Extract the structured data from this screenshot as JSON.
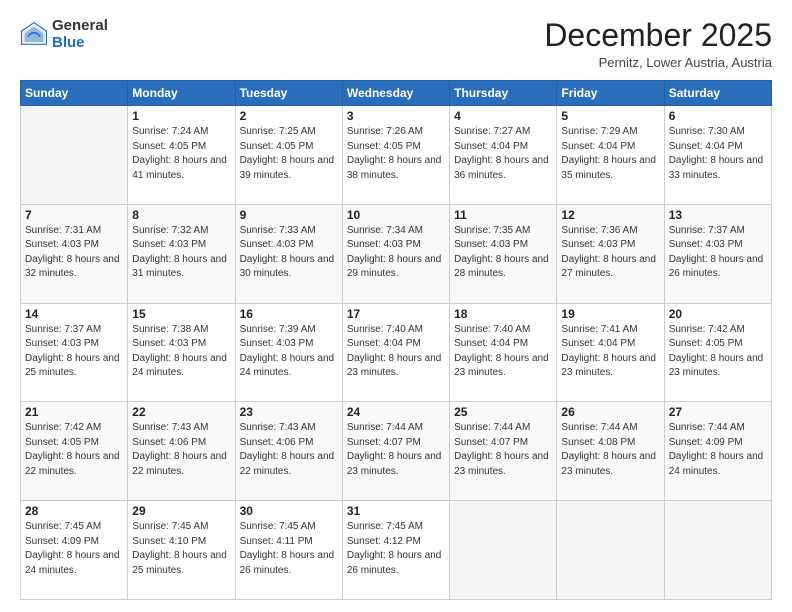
{
  "logo": {
    "general": "General",
    "blue": "Blue"
  },
  "header": {
    "month": "December 2025",
    "location": "Pernitz, Lower Austria, Austria"
  },
  "days": [
    "Sunday",
    "Monday",
    "Tuesday",
    "Wednesday",
    "Thursday",
    "Friday",
    "Saturday"
  ],
  "weeks": [
    [
      {
        "num": "",
        "sunrise": "",
        "sunset": "",
        "daylight": ""
      },
      {
        "num": "1",
        "sunrise": "Sunrise: 7:24 AM",
        "sunset": "Sunset: 4:05 PM",
        "daylight": "Daylight: 8 hours and 41 minutes."
      },
      {
        "num": "2",
        "sunrise": "Sunrise: 7:25 AM",
        "sunset": "Sunset: 4:05 PM",
        "daylight": "Daylight: 8 hours and 39 minutes."
      },
      {
        "num": "3",
        "sunrise": "Sunrise: 7:26 AM",
        "sunset": "Sunset: 4:05 PM",
        "daylight": "Daylight: 8 hours and 38 minutes."
      },
      {
        "num": "4",
        "sunrise": "Sunrise: 7:27 AM",
        "sunset": "Sunset: 4:04 PM",
        "daylight": "Daylight: 8 hours and 36 minutes."
      },
      {
        "num": "5",
        "sunrise": "Sunrise: 7:29 AM",
        "sunset": "Sunset: 4:04 PM",
        "daylight": "Daylight: 8 hours and 35 minutes."
      },
      {
        "num": "6",
        "sunrise": "Sunrise: 7:30 AM",
        "sunset": "Sunset: 4:04 PM",
        "daylight": "Daylight: 8 hours and 33 minutes."
      }
    ],
    [
      {
        "num": "7",
        "sunrise": "Sunrise: 7:31 AM",
        "sunset": "Sunset: 4:03 PM",
        "daylight": "Daylight: 8 hours and 32 minutes."
      },
      {
        "num": "8",
        "sunrise": "Sunrise: 7:32 AM",
        "sunset": "Sunset: 4:03 PM",
        "daylight": "Daylight: 8 hours and 31 minutes."
      },
      {
        "num": "9",
        "sunrise": "Sunrise: 7:33 AM",
        "sunset": "Sunset: 4:03 PM",
        "daylight": "Daylight: 8 hours and 30 minutes."
      },
      {
        "num": "10",
        "sunrise": "Sunrise: 7:34 AM",
        "sunset": "Sunset: 4:03 PM",
        "daylight": "Daylight: 8 hours and 29 minutes."
      },
      {
        "num": "11",
        "sunrise": "Sunrise: 7:35 AM",
        "sunset": "Sunset: 4:03 PM",
        "daylight": "Daylight: 8 hours and 28 minutes."
      },
      {
        "num": "12",
        "sunrise": "Sunrise: 7:36 AM",
        "sunset": "Sunset: 4:03 PM",
        "daylight": "Daylight: 8 hours and 27 minutes."
      },
      {
        "num": "13",
        "sunrise": "Sunrise: 7:37 AM",
        "sunset": "Sunset: 4:03 PM",
        "daylight": "Daylight: 8 hours and 26 minutes."
      }
    ],
    [
      {
        "num": "14",
        "sunrise": "Sunrise: 7:37 AM",
        "sunset": "Sunset: 4:03 PM",
        "daylight": "Daylight: 8 hours and 25 minutes."
      },
      {
        "num": "15",
        "sunrise": "Sunrise: 7:38 AM",
        "sunset": "Sunset: 4:03 PM",
        "daylight": "Daylight: 8 hours and 24 minutes."
      },
      {
        "num": "16",
        "sunrise": "Sunrise: 7:39 AM",
        "sunset": "Sunset: 4:03 PM",
        "daylight": "Daylight: 8 hours and 24 minutes."
      },
      {
        "num": "17",
        "sunrise": "Sunrise: 7:40 AM",
        "sunset": "Sunset: 4:04 PM",
        "daylight": "Daylight: 8 hours and 23 minutes."
      },
      {
        "num": "18",
        "sunrise": "Sunrise: 7:40 AM",
        "sunset": "Sunset: 4:04 PM",
        "daylight": "Daylight: 8 hours and 23 minutes."
      },
      {
        "num": "19",
        "sunrise": "Sunrise: 7:41 AM",
        "sunset": "Sunset: 4:04 PM",
        "daylight": "Daylight: 8 hours and 23 minutes."
      },
      {
        "num": "20",
        "sunrise": "Sunrise: 7:42 AM",
        "sunset": "Sunset: 4:05 PM",
        "daylight": "Daylight: 8 hours and 23 minutes."
      }
    ],
    [
      {
        "num": "21",
        "sunrise": "Sunrise: 7:42 AM",
        "sunset": "Sunset: 4:05 PM",
        "daylight": "Daylight: 8 hours and 22 minutes."
      },
      {
        "num": "22",
        "sunrise": "Sunrise: 7:43 AM",
        "sunset": "Sunset: 4:06 PM",
        "daylight": "Daylight: 8 hours and 22 minutes."
      },
      {
        "num": "23",
        "sunrise": "Sunrise: 7:43 AM",
        "sunset": "Sunset: 4:06 PM",
        "daylight": "Daylight: 8 hours and 22 minutes."
      },
      {
        "num": "24",
        "sunrise": "Sunrise: 7:44 AM",
        "sunset": "Sunset: 4:07 PM",
        "daylight": "Daylight: 8 hours and 23 minutes."
      },
      {
        "num": "25",
        "sunrise": "Sunrise: 7:44 AM",
        "sunset": "Sunset: 4:07 PM",
        "daylight": "Daylight: 8 hours and 23 minutes."
      },
      {
        "num": "26",
        "sunrise": "Sunrise: 7:44 AM",
        "sunset": "Sunset: 4:08 PM",
        "daylight": "Daylight: 8 hours and 23 minutes."
      },
      {
        "num": "27",
        "sunrise": "Sunrise: 7:44 AM",
        "sunset": "Sunset: 4:09 PM",
        "daylight": "Daylight: 8 hours and 24 minutes."
      }
    ],
    [
      {
        "num": "28",
        "sunrise": "Sunrise: 7:45 AM",
        "sunset": "Sunset: 4:09 PM",
        "daylight": "Daylight: 8 hours and 24 minutes."
      },
      {
        "num": "29",
        "sunrise": "Sunrise: 7:45 AM",
        "sunset": "Sunset: 4:10 PM",
        "daylight": "Daylight: 8 hours and 25 minutes."
      },
      {
        "num": "30",
        "sunrise": "Sunrise: 7:45 AM",
        "sunset": "Sunset: 4:11 PM",
        "daylight": "Daylight: 8 hours and 26 minutes."
      },
      {
        "num": "31",
        "sunrise": "Sunrise: 7:45 AM",
        "sunset": "Sunset: 4:12 PM",
        "daylight": "Daylight: 8 hours and 26 minutes."
      },
      {
        "num": "",
        "sunrise": "",
        "sunset": "",
        "daylight": ""
      },
      {
        "num": "",
        "sunrise": "",
        "sunset": "",
        "daylight": ""
      },
      {
        "num": "",
        "sunrise": "",
        "sunset": "",
        "daylight": ""
      }
    ]
  ]
}
